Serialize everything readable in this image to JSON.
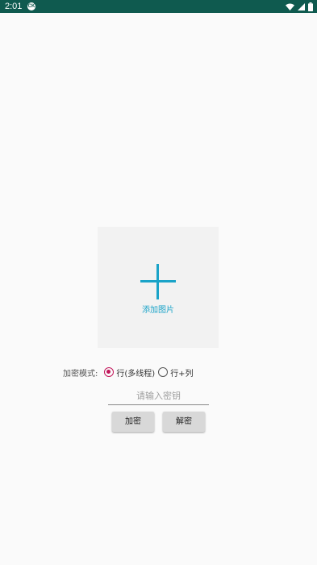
{
  "status_bar": {
    "time": "2:01",
    "notification_icon": "ck-icon",
    "notification_text": "CK",
    "color": "#0f5a4f",
    "icons": [
      "wifi-icon",
      "signal-icon",
      "battery-icon"
    ]
  },
  "image_picker": {
    "icon": "plus-icon",
    "label": "添加图片",
    "accent": "#1aa3c8"
  },
  "encrypt_mode": {
    "label": "加密模式:",
    "options": [
      {
        "label": "行(多线程)",
        "checked": true
      },
      {
        "label": "行+列",
        "checked": false
      }
    ],
    "accent": "#c2185b"
  },
  "key_input": {
    "value": "",
    "placeholder": "请输入密钥"
  },
  "actions": {
    "encrypt_label": "加密",
    "decrypt_label": "解密"
  }
}
